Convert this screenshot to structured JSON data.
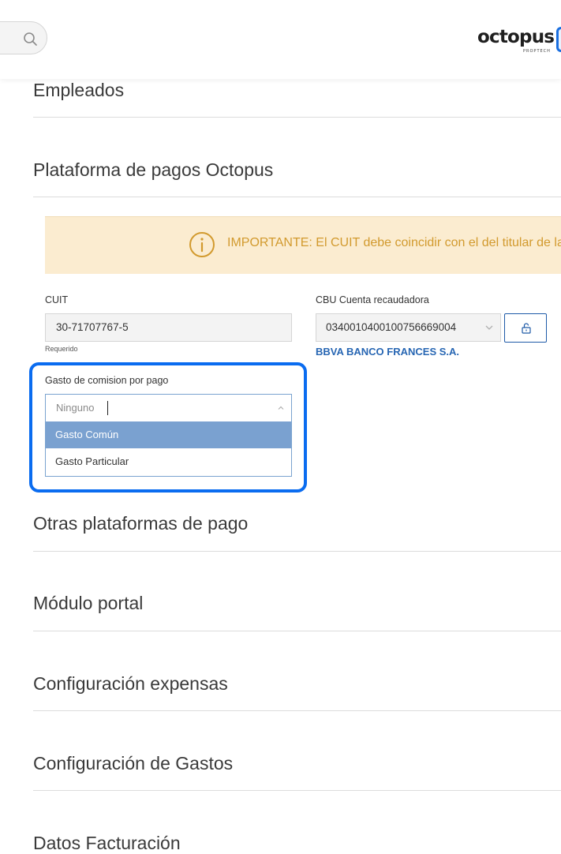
{
  "header": {
    "logo_text": "octopus",
    "logo_subtext": "PROPTECH"
  },
  "sections": [
    {
      "title": "Empleados"
    },
    {
      "title": "Plataforma de pagos Octopus"
    },
    {
      "title": "Otras plataformas de pago"
    },
    {
      "title": "Módulo portal"
    },
    {
      "title": "Configuración expensas"
    },
    {
      "title": "Configuración de Gastos"
    },
    {
      "title": "Datos Facturación"
    }
  ],
  "payments": {
    "alert_text": "IMPORTANTE: El CUIT debe coincidir con el del titular de la",
    "cuit_label": "CUIT",
    "cuit_value": "30-71707767-5",
    "cuit_helper": "Requerido",
    "cbu_label": "CBU Cuenta recaudadora",
    "cbu_value": "0340010400100756669004",
    "bank_name": "BBVA BANCO FRANCES S.A.",
    "commission_label": "Gasto de comision por pago",
    "commission_placeholder": "Ninguno",
    "commission_options": [
      "Gasto Común",
      "Gasto Particular"
    ],
    "highlighted_option": "Gasto Común"
  },
  "colors": {
    "highlight_border": "#0a6cf0",
    "alert_bg": "#fbecd0",
    "alert_text": "#d29a2e",
    "bank_text": "#2766b3",
    "option_highlight": "#7aa1d0"
  }
}
